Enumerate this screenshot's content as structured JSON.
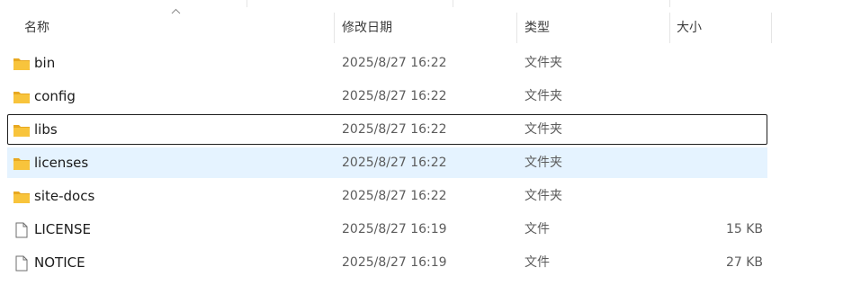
{
  "columns": {
    "name": "名称",
    "date": "修改日期",
    "type": "类型",
    "size": "大小"
  },
  "files": [
    {
      "name": "bin",
      "date": "2025/8/27 16:22",
      "type": "文件夹",
      "size": "",
      "icon": "folder-icon"
    },
    {
      "name": "config",
      "date": "2025/8/27 16:22",
      "type": "文件夹",
      "size": "",
      "icon": "folder-icon"
    },
    {
      "name": "libs",
      "date": "2025/8/27 16:22",
      "type": "文件夹",
      "size": "",
      "icon": "folder-icon"
    },
    {
      "name": "licenses",
      "date": "2025/8/27 16:22",
      "type": "文件夹",
      "size": "",
      "icon": "folder-icon"
    },
    {
      "name": "site-docs",
      "date": "2025/8/27 16:22",
      "type": "文件夹",
      "size": "",
      "icon": "folder-icon"
    },
    {
      "name": "LICENSE",
      "date": "2025/8/27 16:19",
      "type": "文件",
      "size": "15 KB",
      "icon": "file-icon"
    },
    {
      "name": "NOTICE",
      "date": "2025/8/27 16:19",
      "type": "文件",
      "size": "27 KB",
      "icon": "file-icon"
    }
  ],
  "colors": {
    "folder": "#f8c43c",
    "folder_tab": "#e8a820",
    "selected_bg": "#e5f3ff",
    "focus_border": "#1e1e1e"
  }
}
